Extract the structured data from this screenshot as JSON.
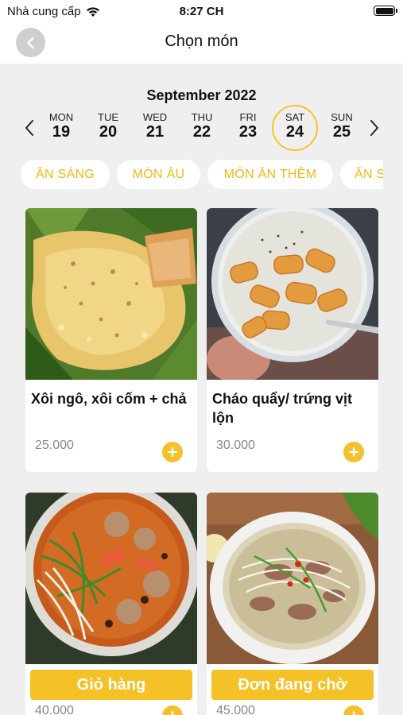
{
  "status_bar": {
    "carrier": "Nhà cung cấp",
    "time": "8:27 CH",
    "wifi_icon": "wifi-icon",
    "battery_icon": "battery-icon"
  },
  "header": {
    "title": "Chọn món",
    "back_icon": "chevron-left-icon"
  },
  "calendar": {
    "month": "September 2022",
    "prev_icon": "chevron-left-icon",
    "next_icon": "chevron-right-icon",
    "days": [
      {
        "name": "MON",
        "num": "19",
        "selected": false
      },
      {
        "name": "TUE",
        "num": "20",
        "selected": false
      },
      {
        "name": "WED",
        "num": "21",
        "selected": false
      },
      {
        "name": "THU",
        "num": "22",
        "selected": false
      },
      {
        "name": "FRI",
        "num": "23",
        "selected": false
      },
      {
        "name": "SAT",
        "num": "24",
        "selected": true
      },
      {
        "name": "SUN",
        "num": "25",
        "selected": false
      }
    ],
    "selected_color": "#f3c42a"
  },
  "categories": [
    "ĂN SÁNG",
    "MÓN ÂU",
    "MÓN ĂN THÊM",
    "ĂN S"
  ],
  "foods": [
    {
      "name": "Xôi ngô, xôi cốm + chả",
      "price": "25.000",
      "image": "xoi-ngo-photo"
    },
    {
      "name": "Cháo quẩy/ trứng vịt lộn",
      "price": "30.000",
      "image": "chao-quay-photo"
    },
    {
      "name": "",
      "price": "40.000",
      "image": "bun-rieu-photo"
    },
    {
      "name": "",
      "price": "45.000",
      "image": "pho-bo-photo"
    }
  ],
  "actions": {
    "cart": "Giỏ hàng",
    "pending_orders": "Đơn đang chờ"
  },
  "colors": {
    "accent": "#f4c126",
    "background": "#efefef",
    "chip_text": "#f0b80f"
  }
}
